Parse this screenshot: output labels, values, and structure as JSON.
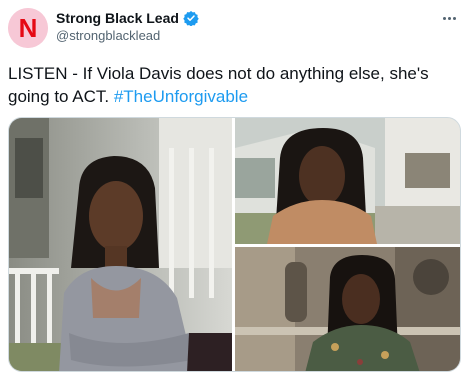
{
  "account": {
    "display_name": "Strong Black Lead",
    "handle": "@strongblacklead",
    "avatar_letter": "N",
    "avatar_bg": "#f7c8d6",
    "avatar_letter_color": "#e50914",
    "verified": true,
    "verified_icon": "verified-badge-icon"
  },
  "tweet": {
    "text": "LISTEN - If Viola Davis does not do anything else, she's going to ACT. ",
    "hashtag": "#TheUnforgivable",
    "hashtag_color": "#1d9bf0"
  },
  "menu": {
    "icon": "more-options-icon"
  },
  "media": {
    "count": 3,
    "photos": [
      {
        "scene": "woman-arms-crossed-on-porch"
      },
      {
        "scene": "woman-in-front-of-house"
      },
      {
        "scene": "woman-seated-indoors"
      }
    ]
  }
}
